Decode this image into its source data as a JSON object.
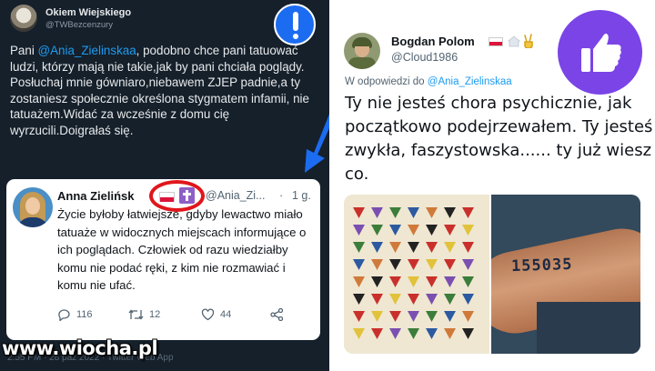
{
  "left_tweet": {
    "author_name": "Okiem Wiejskiego",
    "author_handle": "@TWBezcenzury",
    "text_before": "Pani ",
    "mention": "@Ania_Zielinskaa",
    "text_after": ", podobno chce pani tatuować ludzi, którzy mają nie takie,jak by pani chciała poglądy. Posłuchaj mnie gówniaro,niebawem ZJEP padnie,a ty zostaniesz społecznie określona stygmatem infamii, nie tatuażem.Widać za wcześnie z domu cię wyrzucili.Doigrałaś się.",
    "alert_icon": "exclamation-icon",
    "accent_color": "#1d9bf0",
    "background": "#15202b"
  },
  "quoted_tweet": {
    "author_name": "Anna Zielińsk",
    "author_handle": "@Ania_Zi...",
    "separator": "·",
    "time": "1 g.",
    "text": "Życie byłoby łatwiejsze, gdyby lewactwo miało tatuaże w widocznych miejscach informujące o ich poglądach. Człowiek od razu wiedziałby komu nie podać ręki, z kim nie rozmawiać i komu nie ufać.",
    "actions": {
      "replies": "116",
      "retweets": "12",
      "likes": "44"
    },
    "highlight_color": "#e0161b"
  },
  "footer_meta": "2:55 PM · 28 paź 2022 · Twitter Web App",
  "watermark": "www.wiocha.pl",
  "right_tweet": {
    "author_name": "Bogdan Polom",
    "author_handle": "@Cloud1986",
    "reply_prefix": "W odpowiedzi do ",
    "reply_mention": "@Ania_Zielinskaa",
    "text": "Ty nie jesteś chora psychicznie, jak początkowo podejrzewałem. Ty jesteś zwykła, faszystowska...... ty już wiesz co.",
    "thumb_icon": "thumbs-up-icon",
    "badge_color": "#7b44e6",
    "tattoo_number": "155035"
  }
}
